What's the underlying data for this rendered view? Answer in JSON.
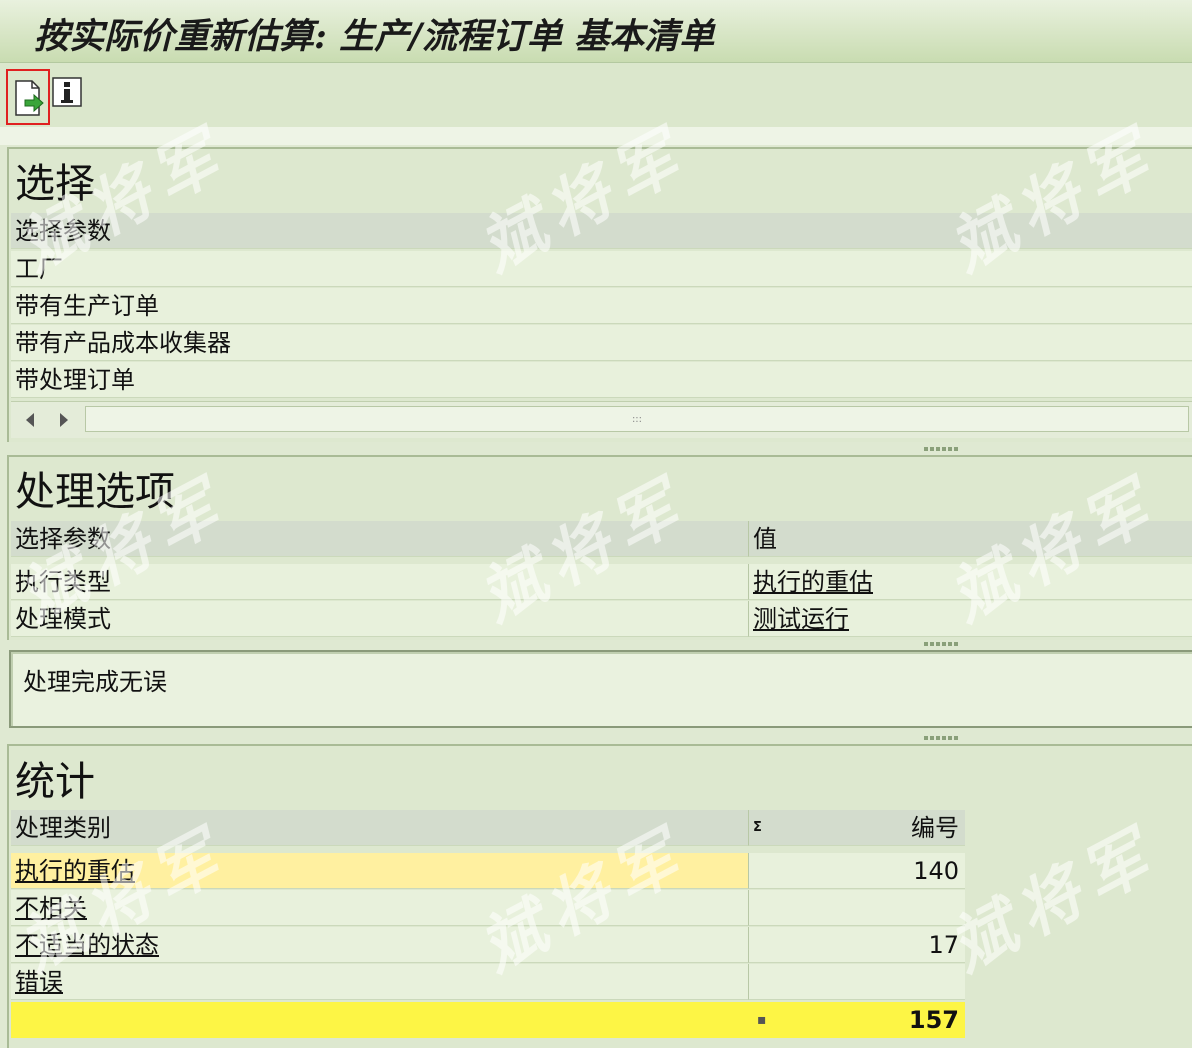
{
  "window": {
    "title": "按实际价重新估算: 生产/流程订单 基本清单"
  },
  "toolbar": {
    "execute_icon": "document-forward-icon",
    "info_icon": "info-icon"
  },
  "selection": {
    "title": "选择",
    "header": "选择参数",
    "rows": [
      "工厂",
      "带有生产订单",
      "带有产品成本收集器",
      "带处理订单"
    ],
    "scroll_glyph": ":::"
  },
  "processing": {
    "title": "处理选项",
    "col_param": "选择参数",
    "col_value": "值",
    "rows": [
      {
        "param": "执行类型",
        "value": "执行的重估"
      },
      {
        "param": "处理模式",
        "value": "测试运行"
      }
    ]
  },
  "message": {
    "text": "处理完成无误"
  },
  "statistics": {
    "title": "统计",
    "col_category": "处理类别",
    "col_sum_marker": "Σ",
    "col_number": "编号",
    "rows": [
      {
        "category": "执行的重估",
        "number": "140",
        "highlight": true
      },
      {
        "category": "不相关",
        "number": "",
        "highlight": false
      },
      {
        "category": "不适当的状态",
        "number": "17",
        "highlight": false
      },
      {
        "category": "错误",
        "number": "",
        "highlight": false
      }
    ],
    "total": {
      "marker": "▪",
      "number": "157"
    }
  },
  "watermark": {
    "text": "斌将军"
  }
}
